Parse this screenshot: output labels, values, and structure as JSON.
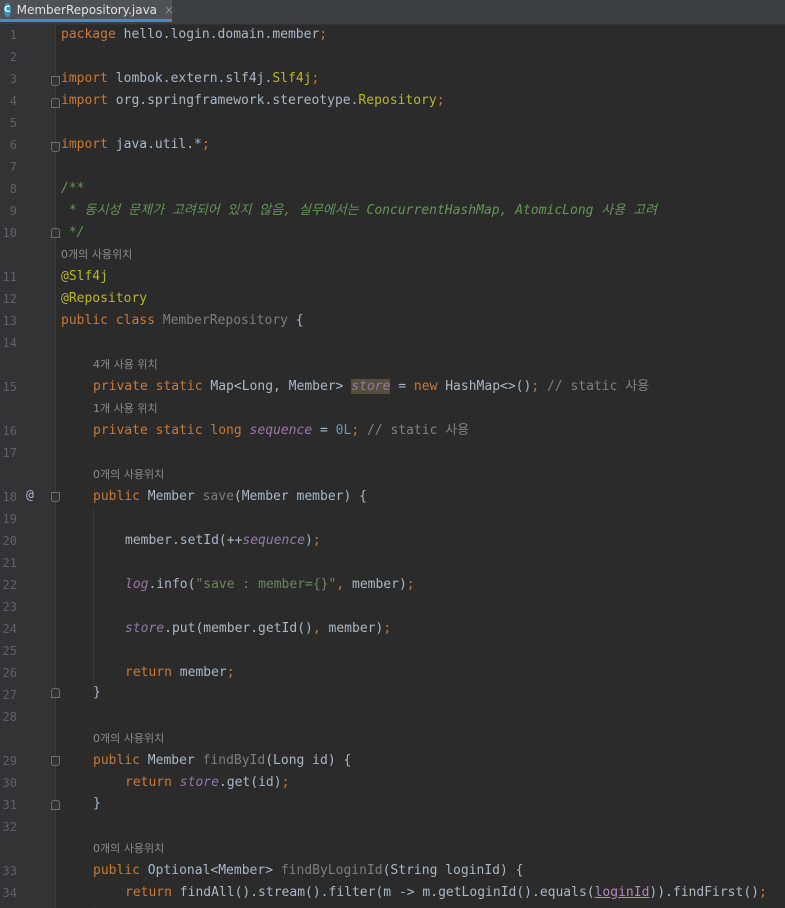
{
  "tab": {
    "file_icon_letter": "C",
    "title": "MemberRepository.java",
    "close": "×"
  },
  "lines": [
    {
      "n": "1"
    },
    {
      "n": "2"
    },
    {
      "n": "3"
    },
    {
      "n": "4"
    },
    {
      "n": "5"
    },
    {
      "n": "6"
    },
    {
      "n": "7"
    },
    {
      "n": "8"
    },
    {
      "n": "9"
    },
    {
      "n": "10"
    },
    {
      "n": "11"
    },
    {
      "n": "12"
    },
    {
      "n": "13"
    },
    {
      "n": "14"
    },
    {
      "n": "15"
    },
    {
      "n": "16"
    },
    {
      "n": "17"
    },
    {
      "n": "18"
    },
    {
      "n": "19"
    },
    {
      "n": "20"
    },
    {
      "n": "21"
    },
    {
      "n": "22"
    },
    {
      "n": "23"
    },
    {
      "n": "24"
    },
    {
      "n": "25"
    },
    {
      "n": "26"
    },
    {
      "n": "27"
    },
    {
      "n": "28"
    },
    {
      "n": "29"
    },
    {
      "n": "30"
    },
    {
      "n": "31"
    },
    {
      "n": "32"
    },
    {
      "n": "33"
    },
    {
      "n": "34"
    }
  ],
  "gutter_marker": "@",
  "hints": {
    "class_usages": "0개의 사용위치",
    "store_usages": "4개 사용 위치",
    "sequence_usages": "1개 사용 위치",
    "save_usages": "0개의 사용위치",
    "findById_usages": "0개의 사용위치",
    "findByLoginId_usages": "0개의 사용위치"
  },
  "code": {
    "l1_kw": "package",
    "l1_rest": " hello.login.domain.member",
    "l1_semi": ";",
    "l3_kw": "import",
    "l3_pkg": " lombok.extern.slf4j.",
    "l3_cls": "Slf4j",
    "l3_semi": ";",
    "l4_kw": "import",
    "l4_pkg": " org.springframework.stereotype.",
    "l4_cls": "Repository",
    "l4_semi": ";",
    "l6_kw": "import",
    "l6_pkg": " java.util.*",
    "l6_semi": ";",
    "l8": "/**",
    "l9": " * 동시성 문제가 고려되어 있지 않음, 실무에서는 ConcurrentHashMap, AtomicLong 사용 고려",
    "l10": " */",
    "l11": "@Slf4j",
    "l12": "@Repository",
    "l13_kw": "public class",
    "l13_name": " MemberRepository",
    "l13_rest": " {",
    "l15_kw": "private static",
    "l15_type": " Map<Long, Member> ",
    "l15_field": "store",
    "l15_eq": " = ",
    "l15_new": "new",
    "l15_rest": " HashMap<>()",
    "l15_semi": ";",
    "l15_cmt": " // static 사용",
    "l16_kw": "private static long",
    "l16_sp": " ",
    "l16_field": "sequence",
    "l16_eq": " = ",
    "l16_num": "0L",
    "l16_semi": ";",
    "l16_cmt": " // static 사용",
    "l18_kw": "public",
    "l18_type": " Member ",
    "l18_name": "save",
    "l18_rest": "(Member member) {",
    "l20_a": "member.setId(++",
    "l20_field": "sequence",
    "l20_b": ")",
    "l20_semi": ";",
    "l22_field": "log",
    "l22_a": ".info(",
    "l22_str": "\"save : member={}\"",
    "l22_comma": ",",
    "l22_b": " member)",
    "l22_semi": ";",
    "l24_field": "store",
    "l24_a": ".put(member.getId()",
    "l24_comma": ",",
    "l24_b": " member)",
    "l24_semi": ";",
    "l26_kw": "return",
    "l26_rest": " member",
    "l26_semi": ";",
    "l27": "}",
    "l29_kw": "public",
    "l29_type": " Member ",
    "l29_name": "findById",
    "l29_rest": "(Long id) {",
    "l30_kw": "return",
    "l30_sp": " ",
    "l30_field": "store",
    "l30_rest": ".get(id)",
    "l30_semi": ";",
    "l31": "}",
    "l33_kw": "public",
    "l33_type": " Optional<Member> ",
    "l33_name": "findByLoginId",
    "l33_rest": "(String loginId) {",
    "l34_kw": "return",
    "l34_a": " findAll().stream().filter(m -> m.getLoginId().equals(",
    "l34_ul": "loginId",
    "l34_b": ")).findFirst()",
    "l34_semi": ";"
  }
}
